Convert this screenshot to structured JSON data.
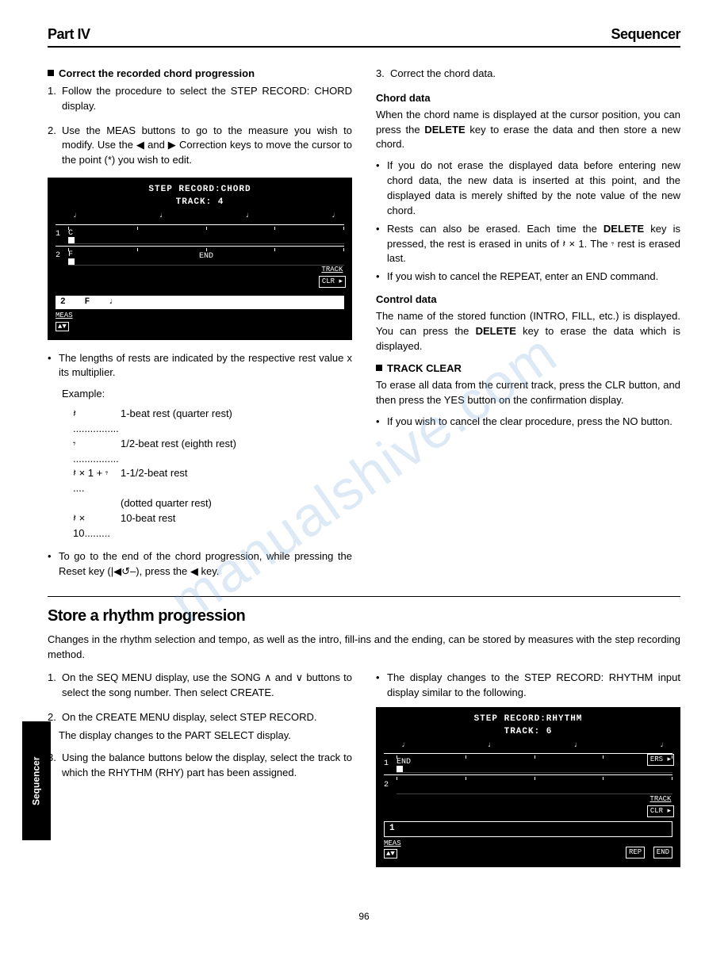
{
  "header": {
    "left": "Part IV",
    "right": "Sequencer"
  },
  "watermark": "manualshive.com",
  "side_tab": "Sequencer",
  "page_number": "96",
  "sec1": {
    "title": "Correct the recorded chord progression",
    "step1": "Follow the procedure to select the STEP RECORD: CHORD display.",
    "step2": "Use the MEAS buttons to go to the measure you wish to modify. Use the ◀ and ▶ Correction keys to move the cursor to the point (*) you wish to edit.",
    "step3": "Correct the chord data.",
    "screen1": {
      "title1": "STEP RECORD:CHORD",
      "title2": "TRACK: 4",
      "m1": "1",
      "chord_c": "C",
      "m2": "2",
      "chord_f": "F",
      "end": "END",
      "track_lbl": "TRACK",
      "clr": "CLR",
      "bar_num": "2",
      "bar_chord": "F",
      "bar_note": "♩",
      "meas_lbl": "MEAS",
      "arrows": "▲▼"
    },
    "rest_note": "The lengths of rests are indicated by the respective rest value x its multiplier.",
    "example_lbl": "Example:",
    "ex1_sym": "𝄽 ................",
    "ex1_desc": "1-beat rest (quarter rest)",
    "ex2_sym": "𝄾 ................",
    "ex2_desc": "1/2-beat rest (eighth rest)",
    "ex3_sym": "𝄽 × 1 + 𝄾 ....",
    "ex3_desc": "1-1/2-beat rest",
    "ex3_desc2": "(dotted quarter rest)",
    "ex4_sym": "𝄽 × 10.........",
    "ex4_desc": "10-beat rest",
    "goto_end": "To go to the end of the chord progression, while pressing the Reset key (|◀↺–), press the ◀ key."
  },
  "chord_data": {
    "head": "Chord data",
    "p1": "When the chord name is displayed at the cursor position, you can press the DELETE key to erase the data and then store a new chord.",
    "b1": "If you do not erase the displayed data before entering new chord data, the new data is inserted at this point, and the displayed data is merely shifted by the note value of the new chord.",
    "b2": "Rests can also be erased. Each time the DELETE key is pressed, the rest is erased in units of 𝄽 × 1. The 𝄾 rest is erased last.",
    "b3": "If you wish to cancel the REPEAT, enter an END command."
  },
  "control_data": {
    "head": "Control data",
    "p1": "The name of the stored function (INTRO, FILL, etc.) is displayed. You can press the DELETE key to erase the data which is displayed."
  },
  "track_clear": {
    "head": "TRACK CLEAR",
    "p1": "To erase all data from the current track, press the CLR button, and then press the YES button on the confirmation display.",
    "b1": "If you wish to cancel the clear procedure, press the NO button."
  },
  "store": {
    "head": "Store a rhythm progression",
    "intro": "Changes in the rhythm selection and tempo, as well as the intro, fill-ins and the ending, can be stored by measures with the step recording method.",
    "s1": "On the SEQ MENU display, use the SONG ∧ and ∨ buttons to select the song number. Then select CREATE.",
    "s2": "On the CREATE MENU display, select STEP RECORD.",
    "s2b": "The display changes to the PART SELECT display.",
    "s3": "Using the balance buttons below the display, select the track to which the RHYTHM (RHY) part has been assigned.",
    "rb": "The display changes to the STEP RECORD: RHYTHM input display similar to the following.",
    "screen2": {
      "title1": "STEP RECORD:RHYTHM",
      "title2": "TRACK: 6",
      "m1": "1",
      "end": "END",
      "m2": "2",
      "ers": "ERS",
      "track_lbl": "TRACK",
      "clr": "CLR",
      "bar_num": "1",
      "meas_lbl": "MEAS",
      "arrows": "▲▼",
      "rep": "REP",
      "endbtn": "END"
    }
  }
}
